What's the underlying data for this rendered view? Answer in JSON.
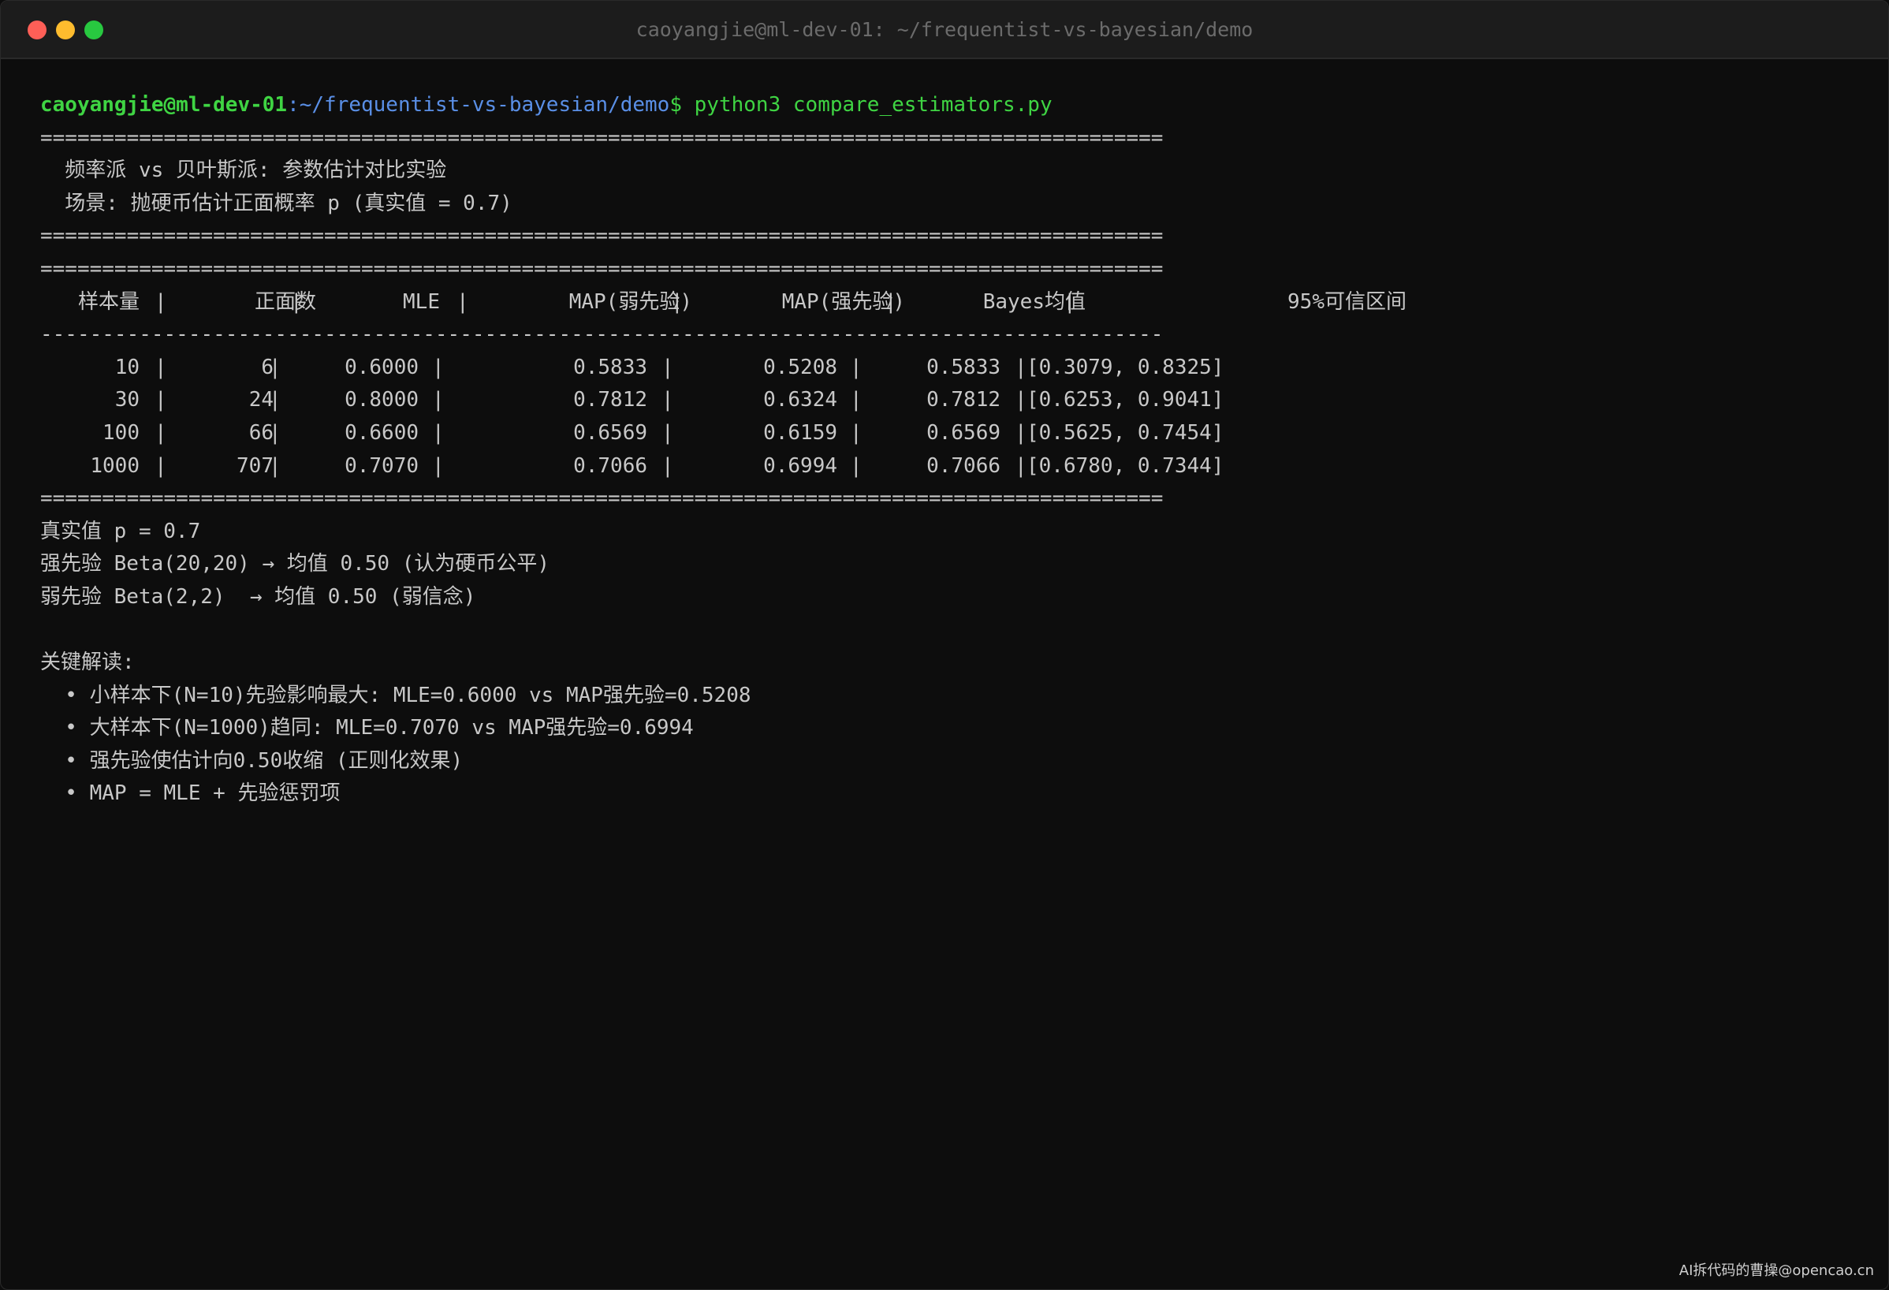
{
  "window": {
    "title": "caoyangjie@ml-dev-01: ~/frequentist-vs-bayesian/demo"
  },
  "prompt": {
    "user_host": "caoyangjie@ml-dev-01",
    "path": ":~/frequentist-vs-bayesian/demo",
    "symbol": "$",
    "command": "python3 compare_estimators.py"
  },
  "output": {
    "rule_double": "===========================================================================================",
    "rule_single": "-------------------------------------------------------------------------------------------",
    "heading_1": "  频率派 vs 贝叶斯派: 参数估计对比实验",
    "heading_2": "  场景: 抛硬币估计正面概率 p (真实值 = 0.7)",
    "table": {
      "headers": [
        "样本量",
        "正面数",
        "MLE",
        "MAP(弱先验)",
        "MAP(强先验)",
        "Bayes均值",
        "95%可信区间"
      ],
      "rows": [
        [
          "10",
          "6",
          "0.6000",
          "0.5833",
          "0.5208",
          "0.5833",
          "[0.3079, 0.8325]"
        ],
        [
          "30",
          "24",
          "0.8000",
          "0.7812",
          "0.6324",
          "0.7812",
          "[0.6253, 0.9041]"
        ],
        [
          "100",
          "66",
          "0.6600",
          "0.6569",
          "0.6159",
          "0.6569",
          "[0.5625, 0.7454]"
        ],
        [
          "1000",
          "707",
          "0.7070",
          "0.7066",
          "0.6994",
          "0.7066",
          "[0.6780, 0.7344]"
        ]
      ]
    },
    "true_value": "真实值 p = 0.7",
    "strong_prior": "强先验 Beta(20,20) → 均值 0.50 (认为硬币公平)",
    "weak_prior": "弱先验 Beta(2,2)  → 均值 0.50 (弱信念)",
    "key_title": "关键解读:",
    "bullets": [
      "  • 小样本下(N=10)先验影响最大: MLE=0.6000 vs MAP强先验=0.5208",
      "  • 大样本下(N=1000)趋同: MLE=0.7070 vs MAP强先验=0.6994",
      "  • 强先验使估计向0.50收缩 (正则化效果)",
      "  • MAP = MLE + 先验惩罚项"
    ]
  },
  "watermark": "AI拆代码的曹操@opencao.cn",
  "colors": {
    "background": "#0d0d0d",
    "prompt_green": "#3fd443",
    "path_blue": "#5a8fe6",
    "text": "#c8c8c8"
  }
}
